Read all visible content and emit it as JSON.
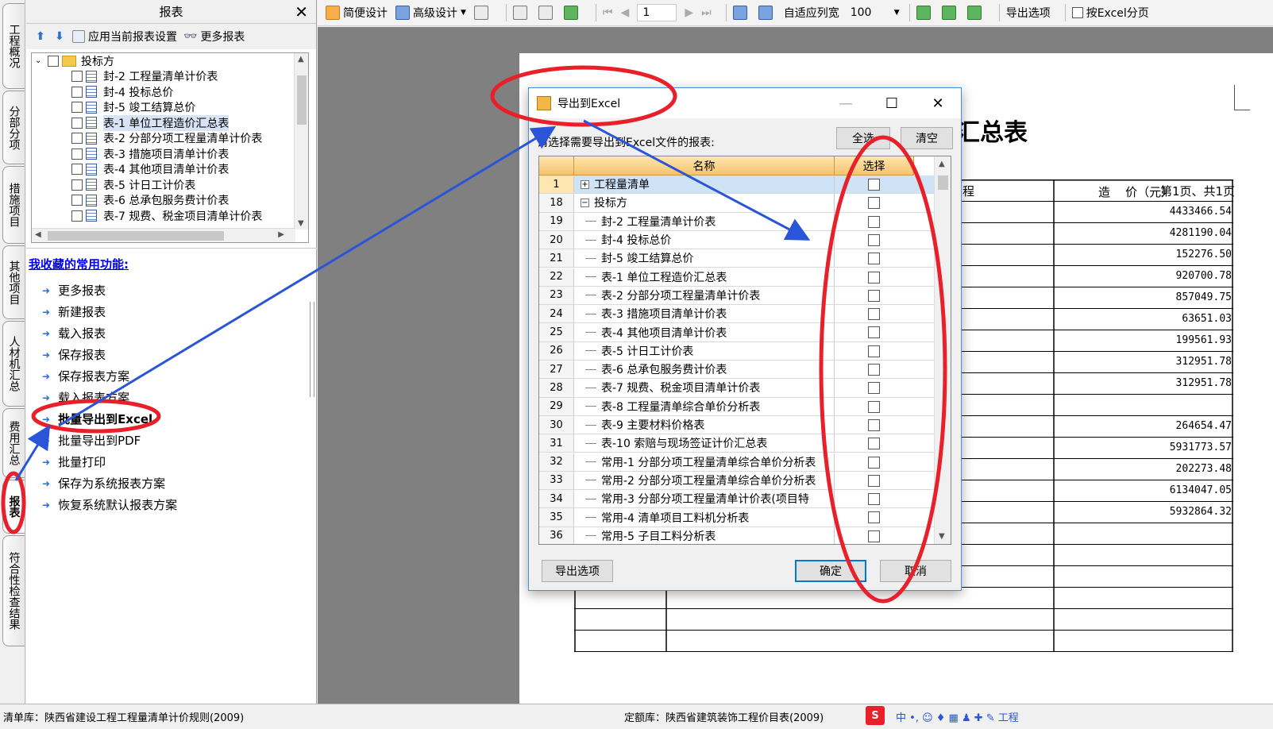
{
  "vtabs": [
    {
      "label": "工程概况"
    },
    {
      "label": "分部分项"
    },
    {
      "label": "措施项目"
    },
    {
      "label": "其他项目"
    },
    {
      "label": "人材机汇总"
    },
    {
      "label": "费用汇总"
    },
    {
      "label": "报表"
    },
    {
      "label": "符合性检查结果"
    }
  ],
  "left_panel": {
    "title": "报表",
    "close": "✕",
    "toolbar": {
      "apply_label": "应用当前报表设置",
      "more_label": "更多报表"
    },
    "tree_root": "投标方",
    "tree_items": [
      {
        "label": "封-2  工程量清单计价表"
      },
      {
        "label": "封-4  投标总价"
      },
      {
        "label": "封-5  竣工结算总价"
      },
      {
        "label": "表-1  单位工程造价汇总表"
      },
      {
        "label": "表-2  分部分项工程量清单计价表"
      },
      {
        "label": "表-3  措施项目清单计价表"
      },
      {
        "label": "表-4  其他项目清单计价表"
      },
      {
        "label": "表-5  计日工计价表"
      },
      {
        "label": "表-6  总承包服务费计价表"
      },
      {
        "label": "表-7  规费、税金项目清单计价表"
      }
    ],
    "fav_title": "我收藏的常用功能:",
    "fav_items": [
      {
        "label": "更多报表"
      },
      {
        "label": "新建报表"
      },
      {
        "label": "载入报表"
      },
      {
        "label": "保存报表"
      },
      {
        "label": "保存报表方案"
      },
      {
        "label": "载入报表方案"
      },
      {
        "label": "批量导出到Excel"
      },
      {
        "label": "批量导出到PDF"
      },
      {
        "label": "批量打印"
      },
      {
        "label": "保存为系统报表方案"
      },
      {
        "label": "恢复系统默认报表方案"
      }
    ]
  },
  "toolbar": {
    "simple_design": "简便设计",
    "advanced_design": "高级设计",
    "page": "1",
    "fit_width": "自适应列宽",
    "zoom": "100",
    "export_options": "导出选项",
    "excel_paging": "按Excel分页"
  },
  "paper": {
    "title": "汇总表",
    "sub": "程",
    "page_info": "第1页、共1页",
    "cost_header": "造    价（元）",
    "costs": [
      "4433466.54",
      "4281190.04",
      "152276.50",
      "920700.78",
      "857049.75",
      "63651.03",
      "199561.93",
      "312951.78",
      "312951.78",
      "",
      "264654.47",
      "5931773.57",
      "202273.48",
      "6134047.05",
      "5932864.32"
    ]
  },
  "dialog": {
    "title": "导出到Excel",
    "prompt": "请选择需要导出到Excel文件的报表:",
    "select_all": "全选",
    "clear": "清空",
    "col_name": "名称",
    "col_select": "选择",
    "rows": [
      {
        "num": "1",
        "name": "工程量清单",
        "level": 0,
        "expander": "+"
      },
      {
        "num": "18",
        "name": "投标方",
        "level": 0,
        "expander": "−"
      },
      {
        "num": "19",
        "name": "封-2  工程量清单计价表",
        "level": 1,
        "expander": ""
      },
      {
        "num": "20",
        "name": "封-4  投标总价",
        "level": 1,
        "expander": ""
      },
      {
        "num": "21",
        "name": "封-5  竣工结算总价",
        "level": 1,
        "expander": ""
      },
      {
        "num": "22",
        "name": "表-1  单位工程造价汇总表",
        "level": 1,
        "expander": ""
      },
      {
        "num": "23",
        "name": "表-2  分部分项工程量清单计价表",
        "level": 1,
        "expander": ""
      },
      {
        "num": "24",
        "name": "表-3  措施项目清单计价表",
        "level": 1,
        "expander": ""
      },
      {
        "num": "25",
        "name": "表-4  其他项目清单计价表",
        "level": 1,
        "expander": ""
      },
      {
        "num": "26",
        "name": "表-5  计日工计价表",
        "level": 1,
        "expander": ""
      },
      {
        "num": "27",
        "name": "表-6  总承包服务费计价表",
        "level": 1,
        "expander": ""
      },
      {
        "num": "28",
        "name": "表-7  规费、税金项目清单计价表",
        "level": 1,
        "expander": ""
      },
      {
        "num": "29",
        "name": "表-8  工程量清单综合单价分析表",
        "level": 1,
        "expander": ""
      },
      {
        "num": "30",
        "name": "表-9  主要材料价格表",
        "level": 1,
        "expander": ""
      },
      {
        "num": "31",
        "name": "表-10  索赔与现场签证计价汇总表",
        "level": 1,
        "expander": ""
      },
      {
        "num": "32",
        "name": "常用-1  分部分项工程量清单综合单价分析表",
        "level": 1,
        "expander": ""
      },
      {
        "num": "33",
        "name": "常用-2  分部分项工程量清单综合单价分析表",
        "level": 1,
        "expander": ""
      },
      {
        "num": "34",
        "name": "常用-3  分部分项工程量清单计价表(项目特",
        "level": 1,
        "expander": ""
      },
      {
        "num": "35",
        "name": "常用-4  清单项目工料机分析表",
        "level": 1,
        "expander": ""
      },
      {
        "num": "36",
        "name": "常用-5  子目工料分析表",
        "level": 1,
        "expander": ""
      }
    ],
    "export_options": "导出选项",
    "ok": "确定",
    "cancel": "取消"
  },
  "statusbar": {
    "left": "清单库：陕西省建设工程工程量清单计价规则(2009)",
    "right": "定额库：陕西省建筑装饰工程价目表(2009)",
    "tray": "中 •, ☺ ♦ ▦ ♟ ✚ ✎ 工程"
  },
  "colors": {
    "accent_red": "#e8202a",
    "arrow_blue": "#2b55d8",
    "grid_header": "#f5c46d"
  }
}
